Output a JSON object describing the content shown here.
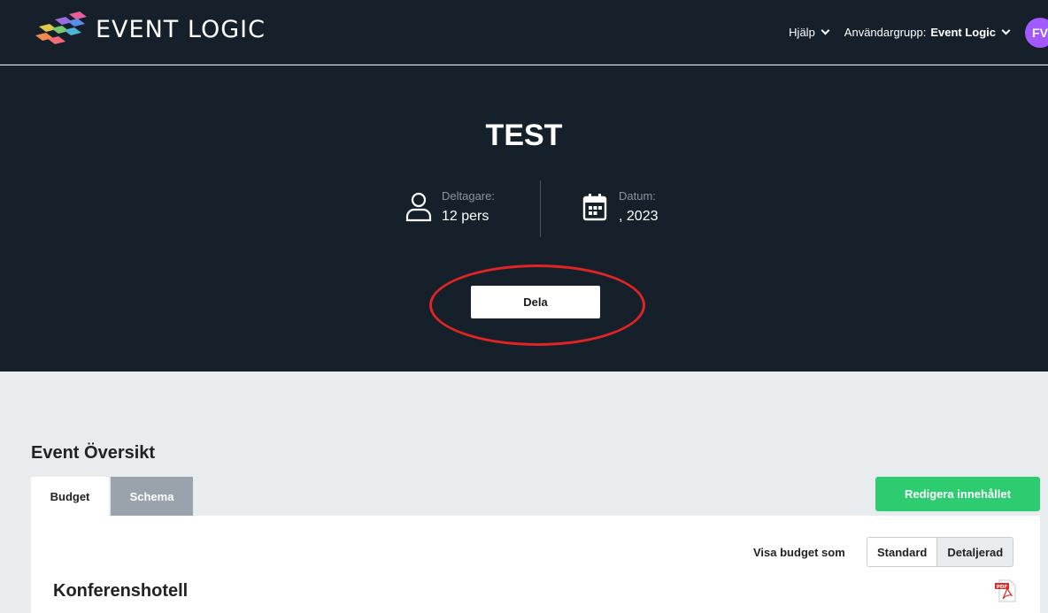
{
  "header": {
    "brand": "EVENT LOGIC",
    "help_label": "Hjälp",
    "usergroup_label": "Användargrupp:",
    "usergroup_value": "Event Logic",
    "avatar_initials": "FV",
    "avatar_color": "#a259ff"
  },
  "hero": {
    "title": "TEST",
    "participants_label": "Deltagare:",
    "participants_value": "12 pers",
    "date_label": "Datum:",
    "date_value": ", 2023",
    "share_label": "Dela",
    "highlight_color": "#e02424"
  },
  "overview": {
    "title": "Event Översikt",
    "tabs": [
      {
        "label": "Budget",
        "active": true
      },
      {
        "label": "Schema",
        "active": false
      }
    ],
    "edit_label": "Redigera innehållet",
    "edit_color": "#2ecc71",
    "view_label": "Visa budget som",
    "view_options": [
      "Standard",
      "Detaljerad"
    ],
    "selected_view": "Detaljerad",
    "section_heading": "Konferenshotell",
    "pdf_icon_text": "PDF"
  }
}
